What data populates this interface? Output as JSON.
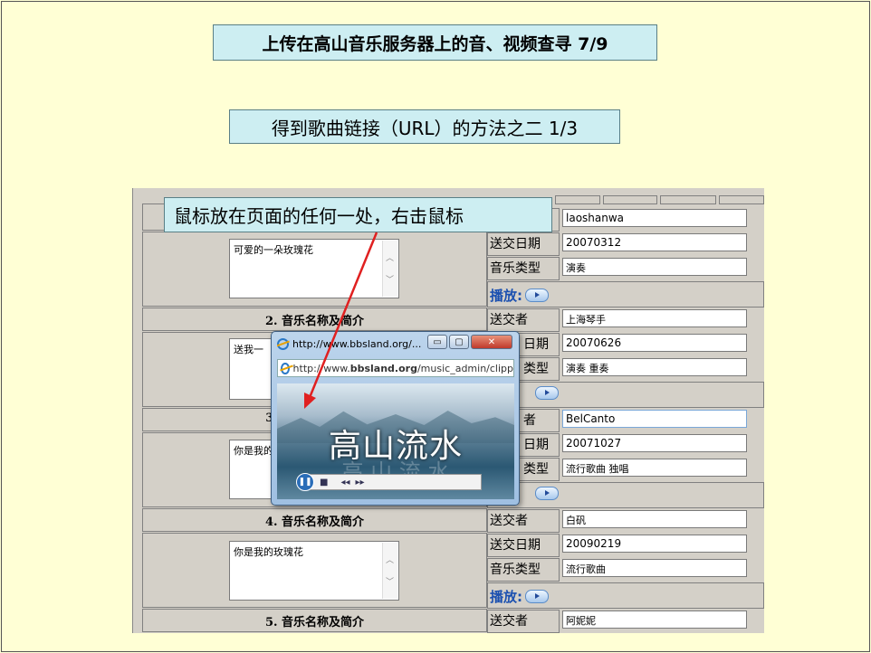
{
  "slide": {
    "title": "上传在高山音乐服务器上的音、视频查寻 7/9",
    "subtitle": "得到歌曲链接（URL）的方法之二 1/3",
    "callout": "鼠标放在页面的任何一处，右击鼠标"
  },
  "records": [
    {
      "description": "可爱的一朵玫瑰花",
      "sender": "laoshanwa",
      "date": "20070312",
      "type": "演奏"
    },
    {
      "section_title": "2. 音乐名称及简介",
      "description": "送我一",
      "sender": "上海琴手",
      "date": "20070626",
      "type": "演奏  重奏"
    },
    {
      "section_title": "3.",
      "description": "你是我的",
      "sender": "BelCanto",
      "date": "20071027",
      "type": "流行歌曲  独唱"
    },
    {
      "section_title": "4. 音乐名称及简介",
      "description": "你是我的玫瑰花",
      "sender": "白矾",
      "date": "20090219",
      "type": "流行歌曲"
    },
    {
      "section_title": "5. 音乐名称及简介",
      "sender": "阿妮妮"
    }
  ],
  "labels": {
    "sender": "送交者",
    "date": "送交日期",
    "type": "音乐类型",
    "play": "播放:",
    "sender_cut": "者",
    "date_cut": "日期",
    "type_cut": "类型"
  },
  "popup": {
    "window_title": "http://www.bbsland.org/...",
    "address_prefix": "http://www.",
    "address_host": "bbsland.org",
    "address_path": "/music_admin/clipp",
    "player_title": "高山流水",
    "player_shadow": "高 山 流 水"
  },
  "colors": {
    "slide_bg": "#ffffd5",
    "box_bg": "#cdeef2",
    "arrow": "#e02020",
    "play_blue": "#1b50b0"
  }
}
